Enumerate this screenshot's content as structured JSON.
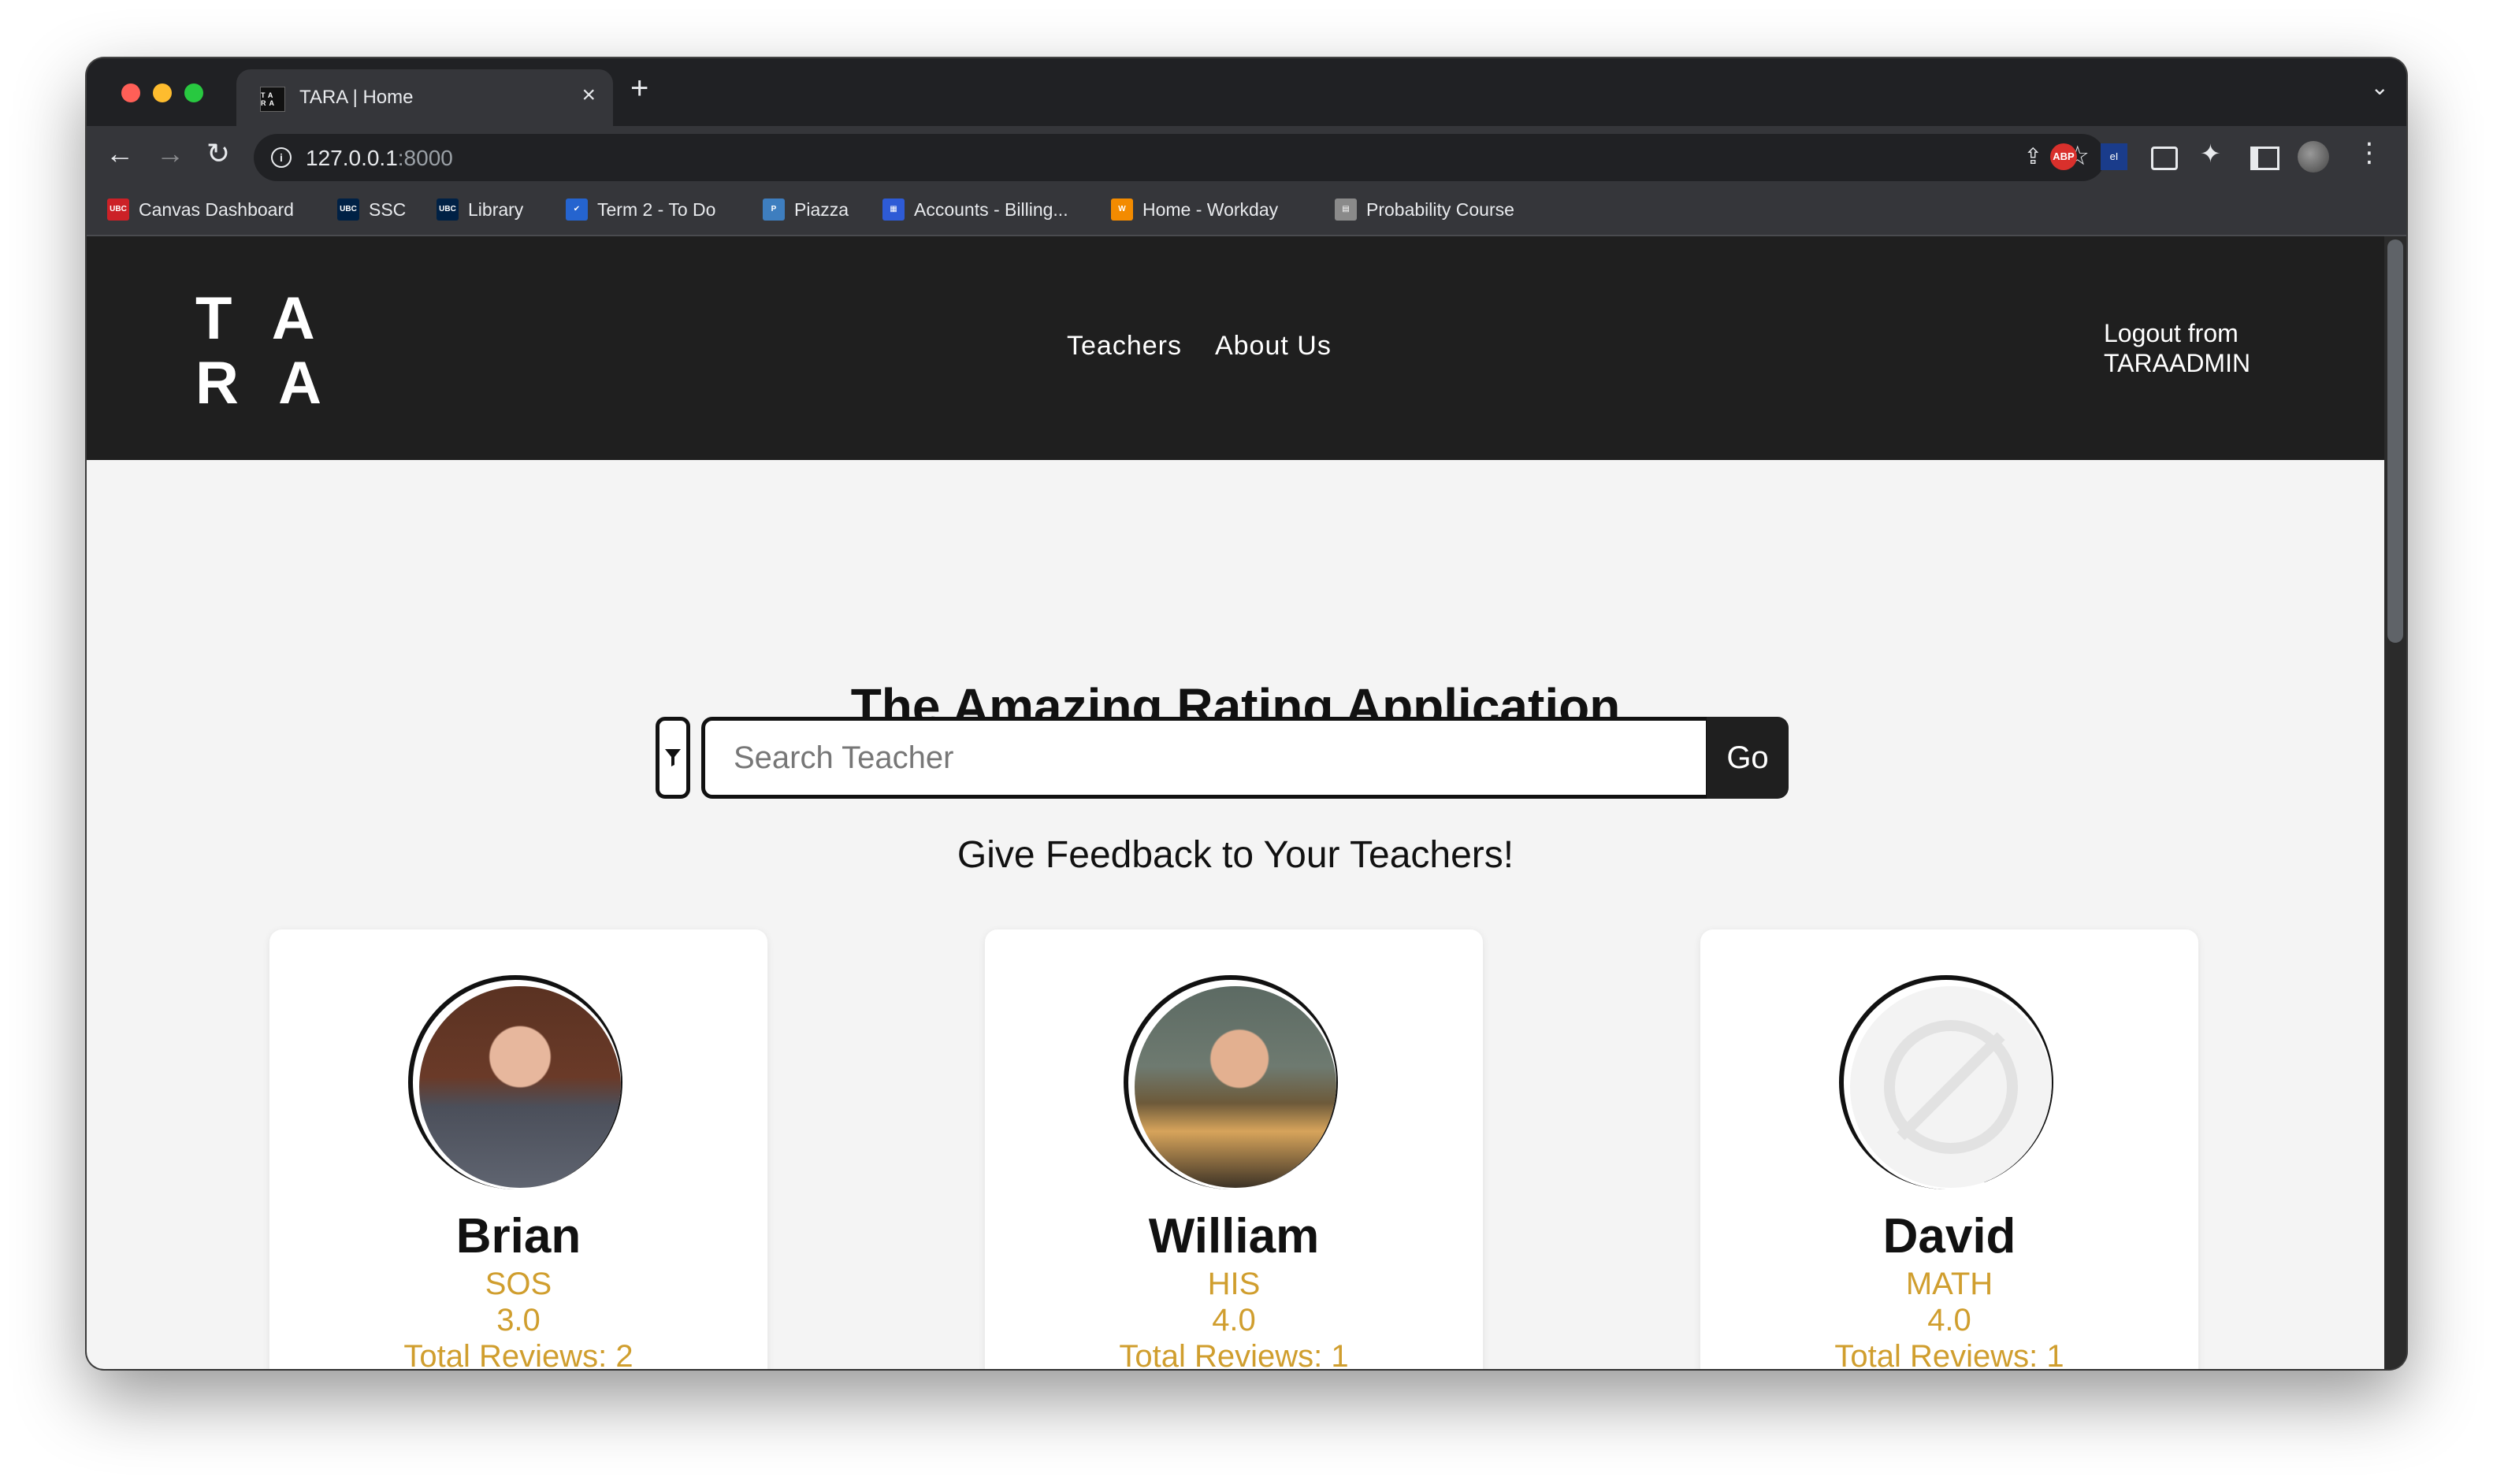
{
  "browser": {
    "tab_title": "TARA | Home",
    "tab_favicon_text": "TA RA",
    "url_host": "127.0.0.1",
    "url_port": ":8000",
    "extensions": {
      "abp": "ABP",
      "ei": "eI"
    },
    "bookmarks": [
      {
        "label": "Canvas Dashboard",
        "icon_text": "UBC",
        "icon_color": "#cc2127"
      },
      {
        "label": "SSC",
        "icon_text": "UBC",
        "icon_color": "#002145"
      },
      {
        "label": "Library",
        "icon_text": "UBC",
        "icon_color": "#002145"
      },
      {
        "label": "Term 2 - To Do",
        "icon_text": "✔",
        "icon_color": "#2564cf"
      },
      {
        "label": "Piazza",
        "icon_text": "P",
        "icon_color": "#3e7ebf"
      },
      {
        "label": "Accounts - Billing...",
        "icon_text": "▦",
        "icon_color": "#2e5bd6"
      },
      {
        "label": "Home - Workday",
        "icon_text": "W",
        "icon_color": "#f38b00"
      },
      {
        "label": "Probability Course",
        "icon_text": "▤",
        "icon_color": "#8a8a8a"
      }
    ]
  },
  "site": {
    "logo_line1": "T A",
    "logo_line2": "R A",
    "nav": [
      "Teachers",
      "About Us"
    ],
    "logout_line1": "Logout from",
    "logout_line2": "TARAADMIN"
  },
  "hero": {
    "title": "The Amazing Rating Application",
    "search_placeholder": "Search Teacher",
    "search_value": "",
    "go_label": "Go",
    "tagline": "Give Feedback to Your Teachers!"
  },
  "teachers": [
    {
      "name": "Brian",
      "subject": "SOS",
      "rating": "3.0",
      "reviews": "Total Reviews: 2"
    },
    {
      "name": "William",
      "subject": "HIS",
      "rating": "4.0",
      "reviews": "Total Reviews: 1"
    },
    {
      "name": "David",
      "subject": "MATH",
      "rating": "4.0",
      "reviews": "Total Reviews: 1"
    }
  ]
}
